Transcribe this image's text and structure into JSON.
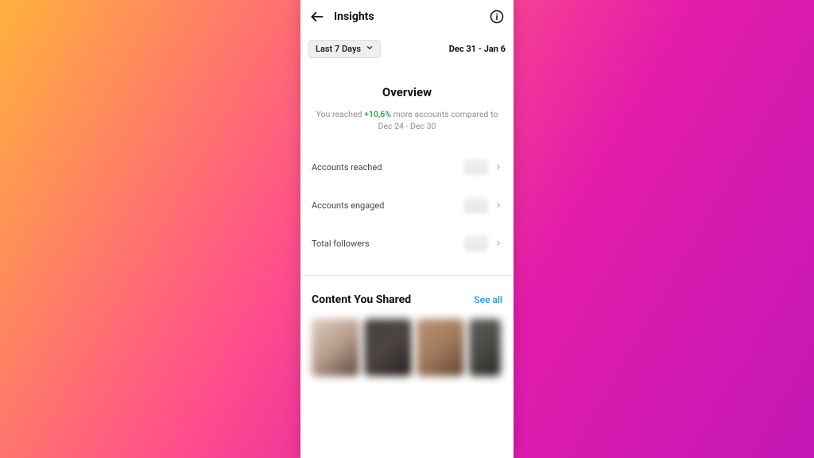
{
  "header": {
    "title": "Insights"
  },
  "filter": {
    "range_label": "Last 7 Days",
    "date_range": "Dec 31 - Jan 6"
  },
  "overview": {
    "title": "Overview",
    "pre_text": "You reached ",
    "pct": "+10,6%",
    "mid_text": " more accounts compared to",
    "compare_range": "Dec 24 - Dec 30"
  },
  "metrics": [
    {
      "label": "Accounts reached"
    },
    {
      "label": "Accounts engaged"
    },
    {
      "label": "Total followers"
    }
  ],
  "content_section": {
    "title": "Content You Shared",
    "see_all": "See all"
  }
}
